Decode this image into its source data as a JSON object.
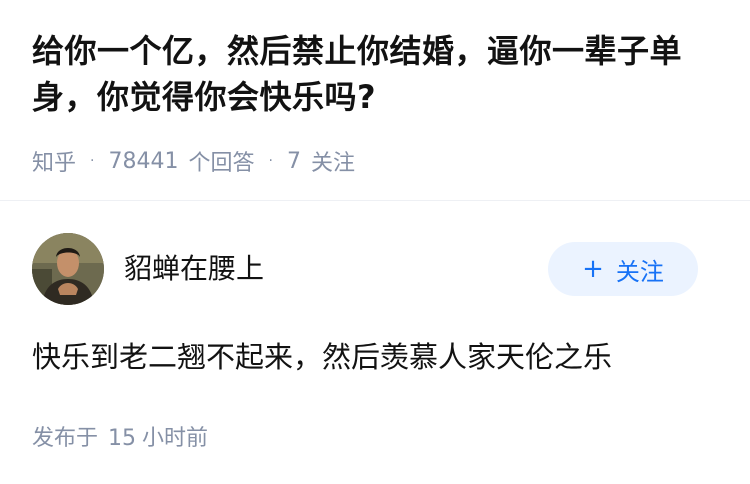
{
  "question": {
    "title": "给你一个亿，然后禁止你结婚，逼你一辈子单身，你觉得你会快乐吗?"
  },
  "meta": {
    "source": "知乎",
    "answer_count": "78441",
    "answer_label": "个回答",
    "follow_count": "7",
    "follow_label": "关注",
    "separator": "·"
  },
  "author": {
    "name": "貂蝉在腰上",
    "avatar_icon": "user-avatar"
  },
  "follow_button": {
    "plus": "+",
    "label": "关注"
  },
  "answer": {
    "text": "快乐到老二翘不起来，然后羡慕人家天伦之乐"
  },
  "publish": {
    "prefix": "发布于",
    "value": "15",
    "unit": "小时前"
  },
  "colors": {
    "meta_gray": "#8590a6",
    "accent_blue": "#1772f6",
    "button_bg": "#ebf3ff",
    "text": "#121212"
  }
}
